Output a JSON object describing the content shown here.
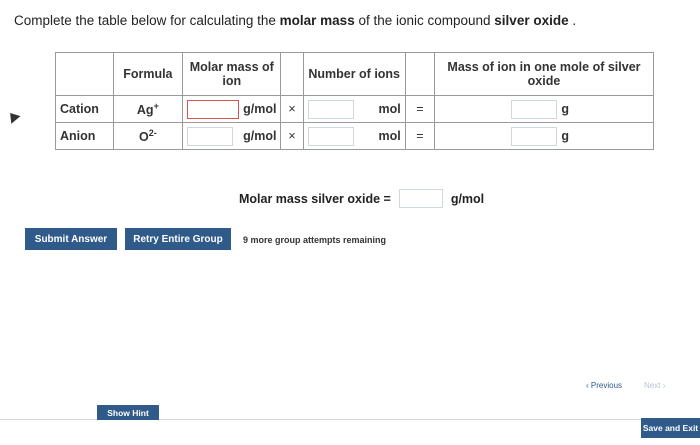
{
  "prompt": {
    "prefix": "Complete the table below for calculating the ",
    "bold1": "molar mass",
    "middle": " of the ionic compound ",
    "bold2": "silver oxide",
    "suffix": " ."
  },
  "table": {
    "headers": {
      "formula": "Formula",
      "molar_mass": "Molar mass of ion",
      "number": "Number of ions",
      "mass": "Mass of ion in one mole of silver oxide"
    },
    "rows": [
      {
        "label": "Cation",
        "formula_base": "Ag",
        "formula_charge": "+",
        "unit1": "g/mol",
        "times": "×",
        "unit2": "mol",
        "equals": "=",
        "unit3": "g"
      },
      {
        "label": "Anion",
        "formula_base": "O",
        "formula_charge": "2-",
        "unit1": "g/mol",
        "times": "×",
        "unit2": "mol",
        "equals": "=",
        "unit3": "g"
      }
    ]
  },
  "molar_mass": {
    "label": "Molar mass silver oxide =",
    "unit": "g/mol"
  },
  "buttons": {
    "submit": "Submit Answer",
    "retry": "Retry Entire Group",
    "attempts": "9 more group attempts remaining",
    "hint": "Show Hint",
    "previous": "Previous",
    "next": "Next",
    "save": "Save and Exit"
  },
  "colors": {
    "accent": "#2f5a8a",
    "active_input": "#d9534f"
  }
}
